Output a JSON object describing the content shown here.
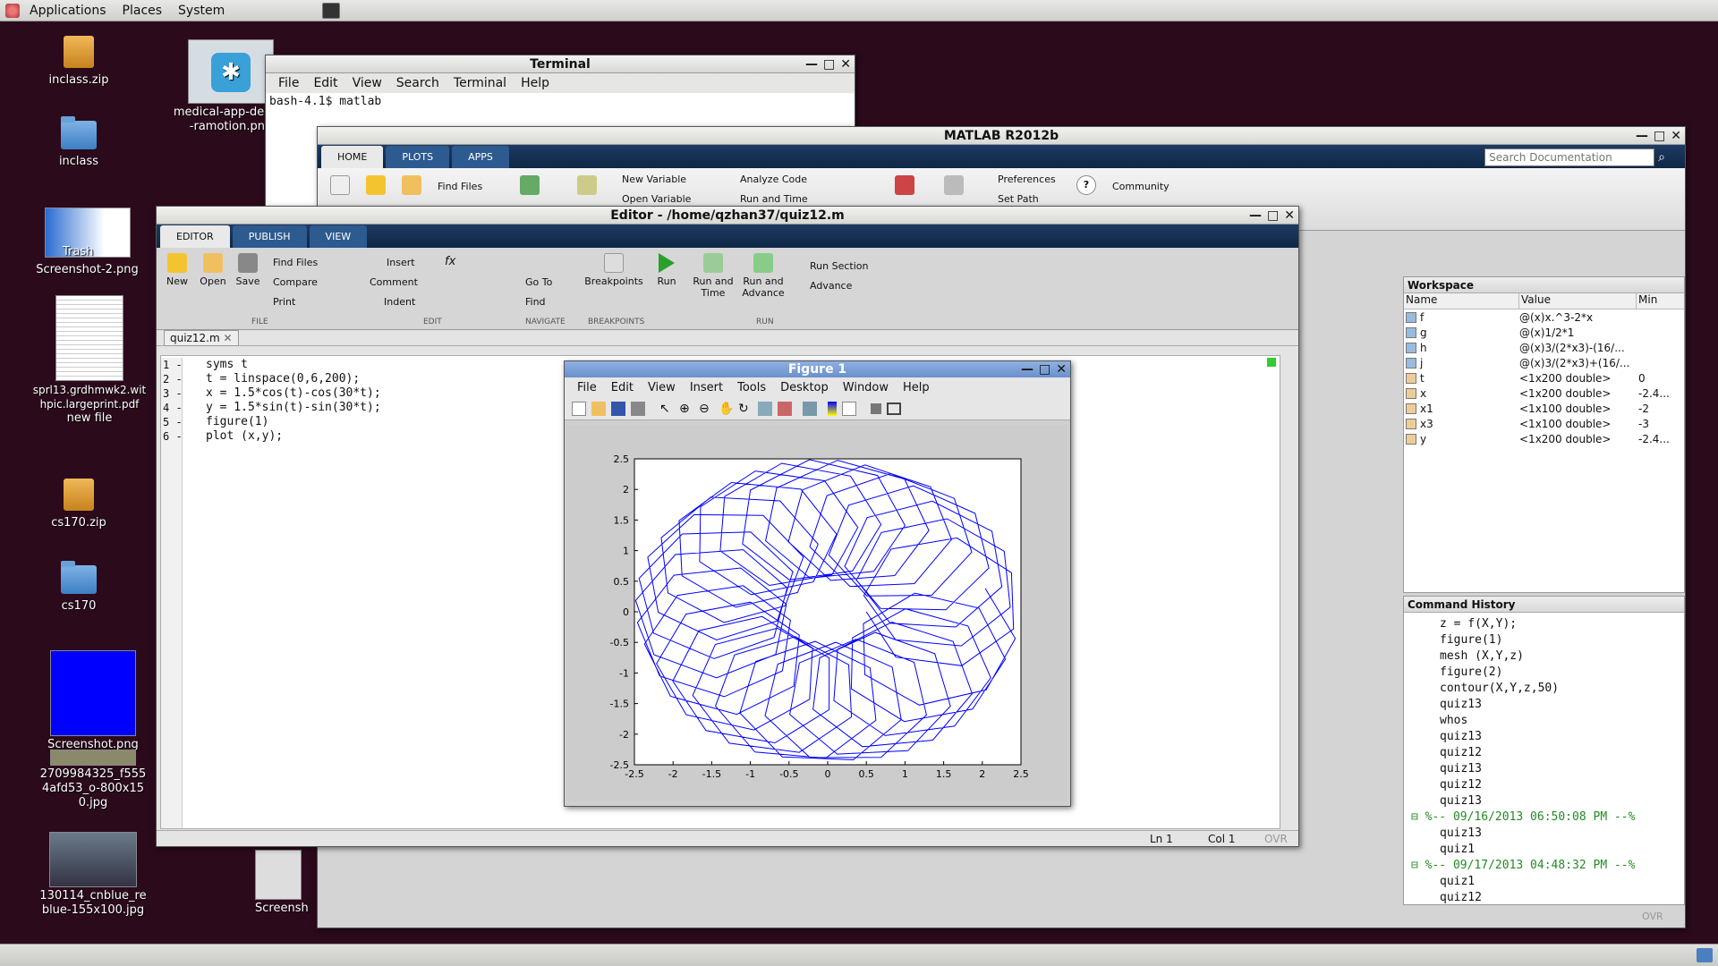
{
  "topbar": {
    "menus": [
      "Applications",
      "Places",
      "System"
    ]
  },
  "desktop": {
    "icons": [
      {
        "label": "inclass.zip"
      },
      {
        "label": "inclass"
      },
      {
        "label": "Trash"
      },
      {
        "label": "Screenshot-2.png"
      },
      {
        "label": "sprl13.grdhmwk2.withpic.largeprint.pdf"
      },
      {
        "label": "new file"
      },
      {
        "label": "cs170.zip"
      },
      {
        "label": "cs170"
      },
      {
        "label": "Screenshot.png"
      },
      {
        "label": "2709984325_f5554afd53_o-800x150.jpg"
      },
      {
        "label": "130114_cnblue_reblue-155x100.jpg"
      },
      {
        "label": "medical-app-design-ramotion.png"
      },
      {
        "label": "Screensh"
      }
    ]
  },
  "terminal": {
    "title": "Terminal",
    "menu": [
      "File",
      "Edit",
      "View",
      "Search",
      "Terminal",
      "Help"
    ],
    "prompt": "bash-4.1$ matlab"
  },
  "matlab": {
    "title": "MATLAB R2012b",
    "tabs": [
      "HOME",
      "PLOTS",
      "APPS"
    ],
    "search_placeholder": "Search Documentation",
    "tools": {
      "new_variable": "New Variable",
      "analyze_code": "Analyze Code",
      "preferences": "Preferences",
      "community": "Community",
      "find_files": "Find Files",
      "open_variable": "Open Variable",
      "run_and_time": "Run and Time",
      "set_path": "Set Path"
    },
    "workspace": {
      "title": "Workspace",
      "columns": [
        "Name",
        "Value",
        "Min"
      ],
      "rows": [
        {
          "name": "f",
          "value": "@(x)x.^3-2*x",
          "min": ""
        },
        {
          "name": "g",
          "value": "@(x)1/2*1",
          "min": ""
        },
        {
          "name": "h",
          "value": "@(x)3/(2*x3)-(16/...",
          "min": ""
        },
        {
          "name": "j",
          "value": "@(x)3/(2*x3)+(16/...",
          "min": ""
        },
        {
          "name": "t",
          "value": "<1x200 double>",
          "min": "0"
        },
        {
          "name": "x",
          "value": "<1x200 double>",
          "min": "-2.4..."
        },
        {
          "name": "x1",
          "value": "<1x100 double>",
          "min": "-2"
        },
        {
          "name": "x3",
          "value": "<1x100 double>",
          "min": "-3"
        },
        {
          "name": "y",
          "value": "<1x200 double>",
          "min": "-2.4..."
        }
      ]
    },
    "history": {
      "title": "Command History",
      "lines": [
        {
          "text": "z = f(X,Y);",
          "session": false
        },
        {
          "text": "figure(1)",
          "session": false
        },
        {
          "text": "mesh (X,Y,z)",
          "session": false
        },
        {
          "text": "figure(2)",
          "session": false
        },
        {
          "text": "contour(X,Y,z,50)",
          "session": false
        },
        {
          "text": "quiz13",
          "session": false
        },
        {
          "text": "whos",
          "session": false
        },
        {
          "text": "quiz13",
          "session": false
        },
        {
          "text": "quiz12",
          "session": false
        },
        {
          "text": "quiz13",
          "session": false
        },
        {
          "text": "quiz12",
          "session": false
        },
        {
          "text": "quiz13",
          "session": false
        },
        {
          "text": "%-- 09/16/2013 06:50:08 PM --%",
          "session": true
        },
        {
          "text": "quiz13",
          "session": false
        },
        {
          "text": "quiz1",
          "session": false
        },
        {
          "text": "%-- 09/17/2013 04:48:32 PM --%",
          "session": true
        },
        {
          "text": "quiz1",
          "session": false
        },
        {
          "text": "quiz12",
          "session": false
        }
      ]
    },
    "status_ovr": "OVR"
  },
  "editor": {
    "title": "Editor - /home/qzhan37/quiz12.m",
    "tabs": [
      "EDITOR",
      "PUBLISH",
      "VIEW"
    ],
    "buttons": {
      "new": "New",
      "open": "Open",
      "save": "Save",
      "find_files": "Find Files",
      "compare": "Compare",
      "print": "Print",
      "insert": "Insert",
      "comment": "Comment",
      "indent": "Indent",
      "go_to": "Go To",
      "find": "Find",
      "breakpoints": "Breakpoints",
      "run": "Run",
      "run_and_time": "Run and Time",
      "run_and_advance": "Run and Advance",
      "run_section": "Run Section",
      "advance": "Advance"
    },
    "sections": [
      "FILE",
      "EDIT",
      "NAVIGATE",
      "BREAKPOINTS",
      "RUN"
    ],
    "file_tab": "quiz12.m",
    "code": [
      "syms t",
      "t = linspace(0,6,200);",
      "x = 1.5*cos(t)-cos(30*t);",
      "y = 1.5*sin(t)-sin(30*t);",
      "figure(1)",
      "plot (x,y);"
    ],
    "status": {
      "ln": "Ln  1",
      "col": "Col  1",
      "ovr": "OVR"
    }
  },
  "figure": {
    "title": "Figure 1",
    "menu": [
      "File",
      "Edit",
      "View",
      "Insert",
      "Tools",
      "Desktop",
      "Window",
      "Help"
    ]
  },
  "chart_data": {
    "type": "line",
    "title": "",
    "xlabel": "",
    "ylabel": "",
    "xlim": [
      -2.5,
      2.5
    ],
    "ylim": [
      -2.5,
      2.5
    ],
    "xticks": [
      "-2.5",
      "-2",
      "-1.5",
      "-1",
      "-0.5",
      "0",
      "0.5",
      "1",
      "1.5",
      "2",
      "2.5"
    ],
    "yticks": [
      "2.5",
      "2",
      "1.5",
      "1",
      "0.5",
      "0",
      "-0.5",
      "-1",
      "-1.5",
      "-2",
      "-2.5"
    ],
    "t_start": 0,
    "t_end": 6,
    "samples": 200,
    "x_formula": "1.5*cos(t)-cos(30*t)",
    "y_formula": "1.5*sin(t)-sin(30*t)",
    "color": "#0000ff"
  }
}
